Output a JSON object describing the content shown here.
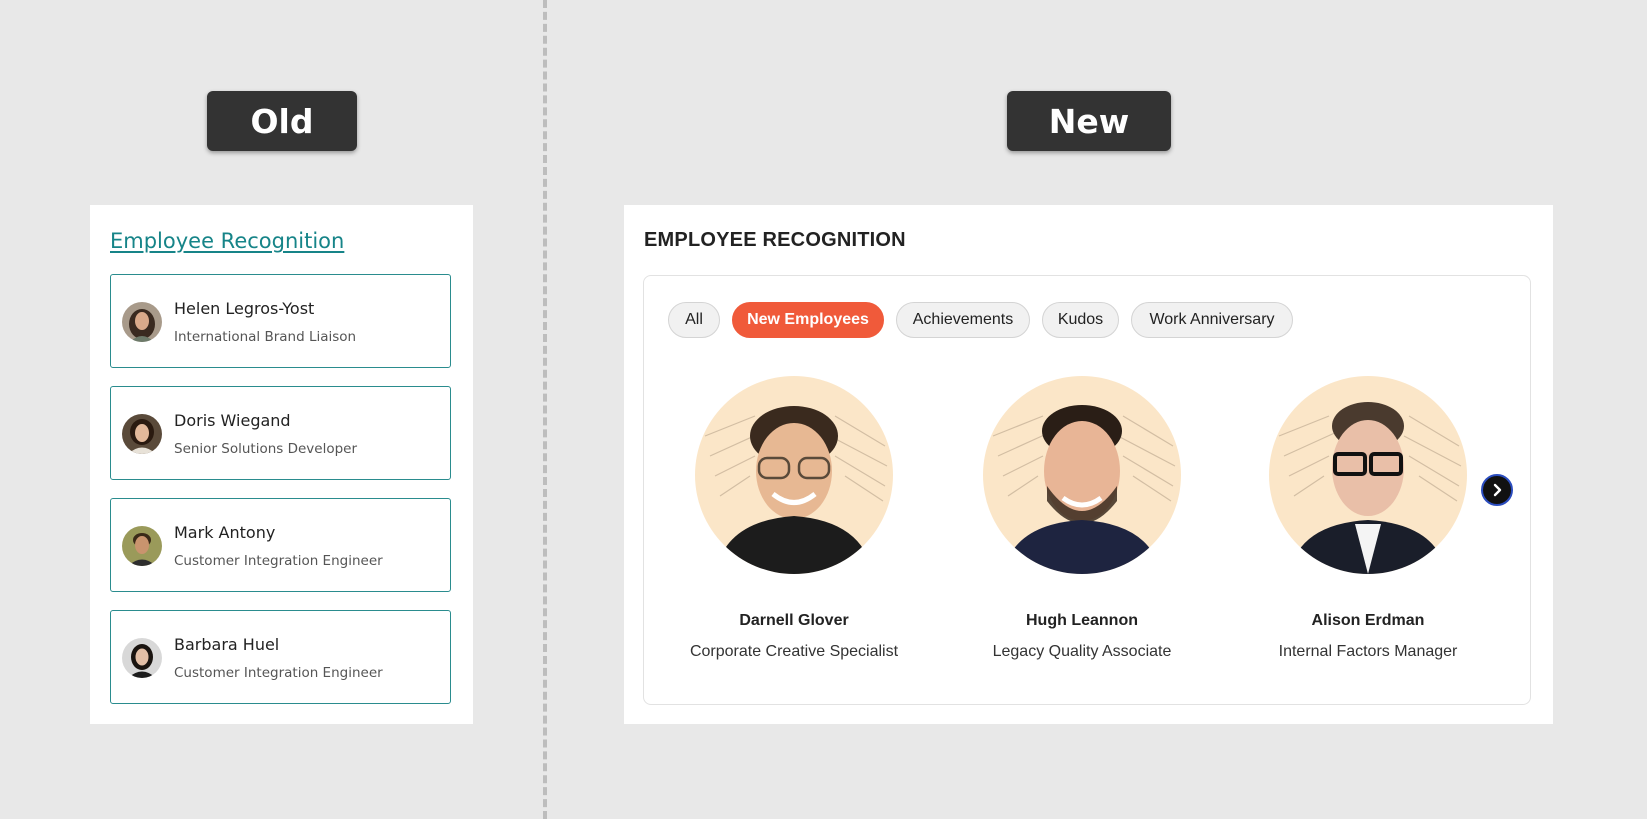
{
  "labels": {
    "old": "Old",
    "new": "New"
  },
  "old_widget": {
    "title": "Employee Recognition",
    "employees": [
      {
        "name": "Helen Legros-Yost",
        "role": "International Brand Liaison"
      },
      {
        "name": "Doris Wiegand",
        "role": "Senior Solutions Developer"
      },
      {
        "name": "Mark Antony",
        "role": "Customer Integration Engineer"
      },
      {
        "name": "Barbara Huel",
        "role": "Customer Integration Engineer"
      }
    ]
  },
  "new_widget": {
    "title": "EMPLOYEE RECOGNITION",
    "filters": [
      {
        "label": "All",
        "active": false
      },
      {
        "label": "New Employees",
        "active": true
      },
      {
        "label": "Achievements",
        "active": false
      },
      {
        "label": "Kudos",
        "active": false
      },
      {
        "label": "Work Anniversary",
        "active": false
      }
    ],
    "profiles": [
      {
        "name": "Darnell Glover",
        "role": "Corporate Creative Specialist"
      },
      {
        "name": "Hugh Leannon",
        "role": "Legacy Quality Associate"
      },
      {
        "name": "Alison Erdman",
        "role": "Internal Factors Manager"
      }
    ],
    "next_icon": "chevron-right-icon"
  },
  "colors": {
    "background": "#e8e8e8",
    "tag": "#333333",
    "old_accent": "#168488",
    "active_filter": "#f05a3a",
    "portrait_bg": "#fbe6c8"
  }
}
